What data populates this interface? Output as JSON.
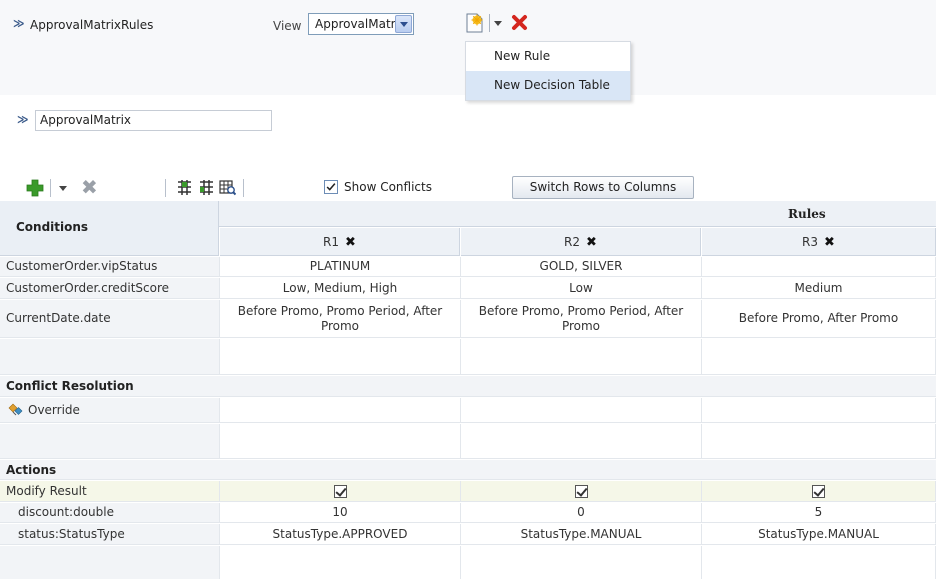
{
  "header": {
    "ruleset_title": "ApprovalMatrixRules",
    "view_label": "View",
    "view_value": "ApprovalMatrix"
  },
  "new_menu": {
    "items": [
      "New Rule",
      "New Decision Table"
    ],
    "highlighted": "New Decision Table"
  },
  "decision_table_name": "ApprovalMatrix",
  "toolbar": {
    "show_conflicts_label": "Show Conflicts",
    "show_conflicts_checked": true,
    "switch_label": "Switch Rows to Columns"
  },
  "table": {
    "conditions_header": "Conditions",
    "rules_header": "Rules",
    "rules": [
      "R1",
      "R2",
      "R3"
    ],
    "condition_rows": [
      {
        "label": "CustomerOrder.vipStatus",
        "values": [
          "PLATINUM",
          "GOLD, SILVER",
          ""
        ]
      },
      {
        "label": "CustomerOrder.creditScore",
        "values": [
          "Low, Medium, High",
          "Low",
          "Medium"
        ]
      },
      {
        "label": "CurrentDate.date",
        "values": [
          "Before Promo, Promo Period, After Promo",
          "Before Promo, Promo Period, After Promo",
          "Before Promo, After Promo"
        ]
      }
    ],
    "conflict_section": "Conflict Resolution",
    "override_label": "Override",
    "actions_section": "Actions",
    "action_label": "Modify Result",
    "action_checked": [
      true,
      true,
      true
    ],
    "action_rows": [
      {
        "label": "discount:double",
        "values": [
          "10",
          "0",
          "5"
        ]
      },
      {
        "label": "status:StatusType",
        "values": [
          "StatusType.APPROVED",
          "StatusType.MANUAL",
          "StatusType.MANUAL"
        ]
      }
    ]
  },
  "colors": {
    "delete_red": "#d4261e",
    "add_green": "#3a9a2a",
    "header_bg": "#edf1f6",
    "highlight": "#d9e6f6"
  }
}
